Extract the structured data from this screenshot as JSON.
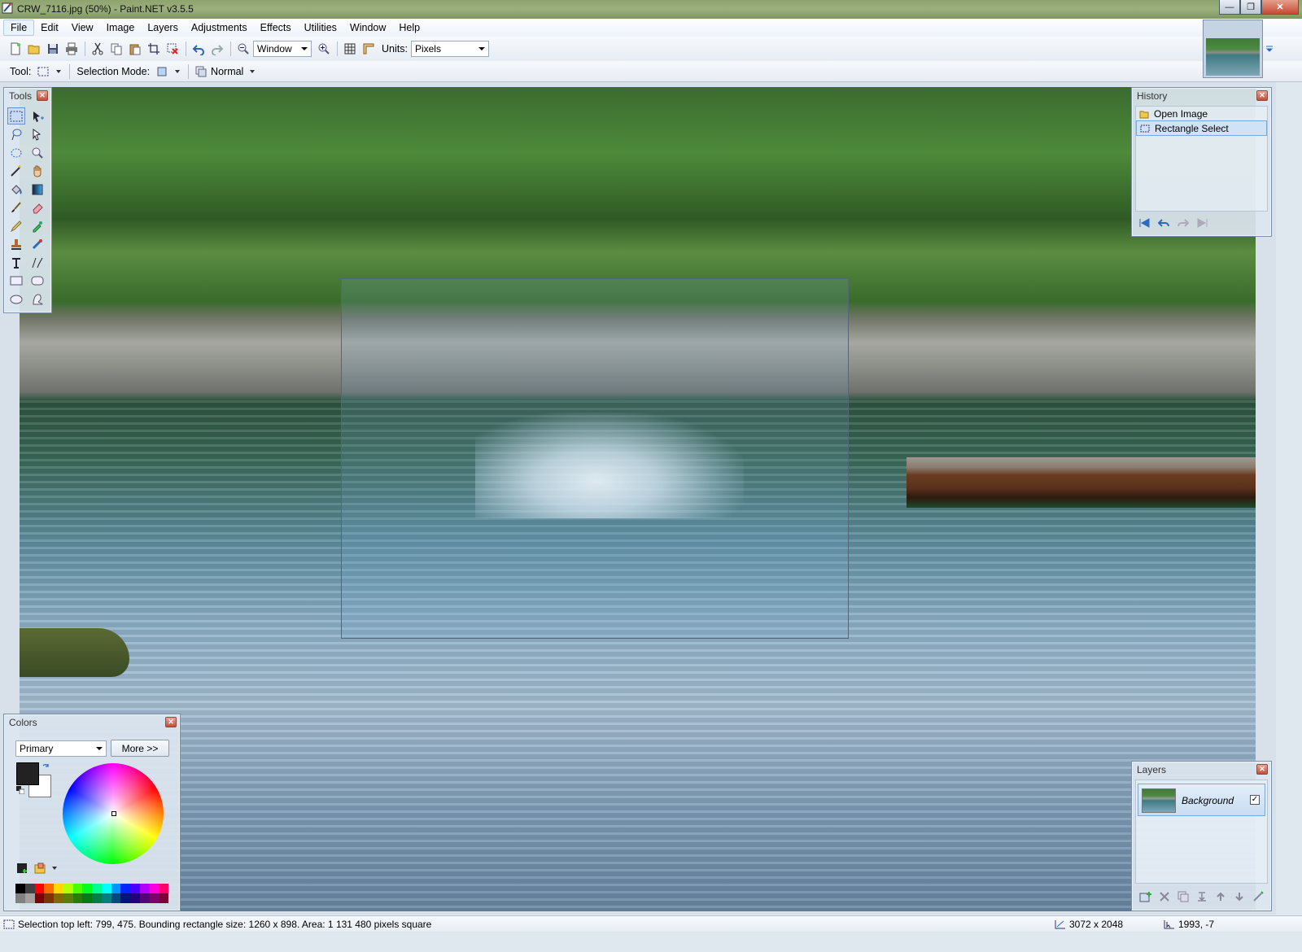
{
  "window": {
    "title": "CRW_7116.jpg (50%) - Paint.NET v3.5.5",
    "controls": {
      "minimize": "—",
      "maximize": "❐",
      "close": "✕"
    }
  },
  "menu": {
    "items": [
      "File",
      "Edit",
      "View",
      "Image",
      "Layers",
      "Adjustments",
      "Effects",
      "Utilities",
      "Window",
      "Help"
    ]
  },
  "toolbar": {
    "zoom_value": "Window",
    "units_label": "Units:",
    "units_value": "Pixels"
  },
  "toolbar2": {
    "tool_label": "Tool:",
    "selection_mode_label": "Selection Mode:",
    "blend_mode": "Normal"
  },
  "panels": {
    "tools": {
      "title": "Tools"
    },
    "history": {
      "title": "History",
      "items": [
        "Open Image",
        "Rectangle Select"
      ],
      "selected_index": 1
    },
    "colors": {
      "title": "Colors",
      "mode": "Primary",
      "more_label": "More >>",
      "primary_color": "#222222",
      "secondary_color": "#ffffff",
      "palette_top": [
        "#000000",
        "#404040",
        "#ff0000",
        "#ff6a00",
        "#ffd800",
        "#b6ff00",
        "#4cff00",
        "#00ff21",
        "#00ff90",
        "#00ffff",
        "#0094ff",
        "#0026ff",
        "#4800ff",
        "#b200ff",
        "#ff00dc",
        "#ff006e"
      ],
      "palette_bottom": [
        "#808080",
        "#a0a0a0",
        "#7f0000",
        "#7f3300",
        "#7f6a00",
        "#5b7f00",
        "#267f00",
        "#007f0e",
        "#007f46",
        "#007f7f",
        "#004a7f",
        "#00137f",
        "#21007f",
        "#57007f",
        "#7f006e",
        "#7f0037"
      ]
    },
    "layers": {
      "title": "Layers",
      "items": [
        {
          "name": "Background",
          "visible": true
        }
      ]
    }
  },
  "status": {
    "selection_info": "Selection top left: 799, 475. Bounding rectangle size: 1260 x 898. Area: 1 131 480 pixels square",
    "image_size": "3072 x 2048",
    "cursor_position": "1993, -7"
  },
  "colors_theme": {
    "accent": "#6c90c0",
    "selection_highlight": "#cfe2f6"
  }
}
